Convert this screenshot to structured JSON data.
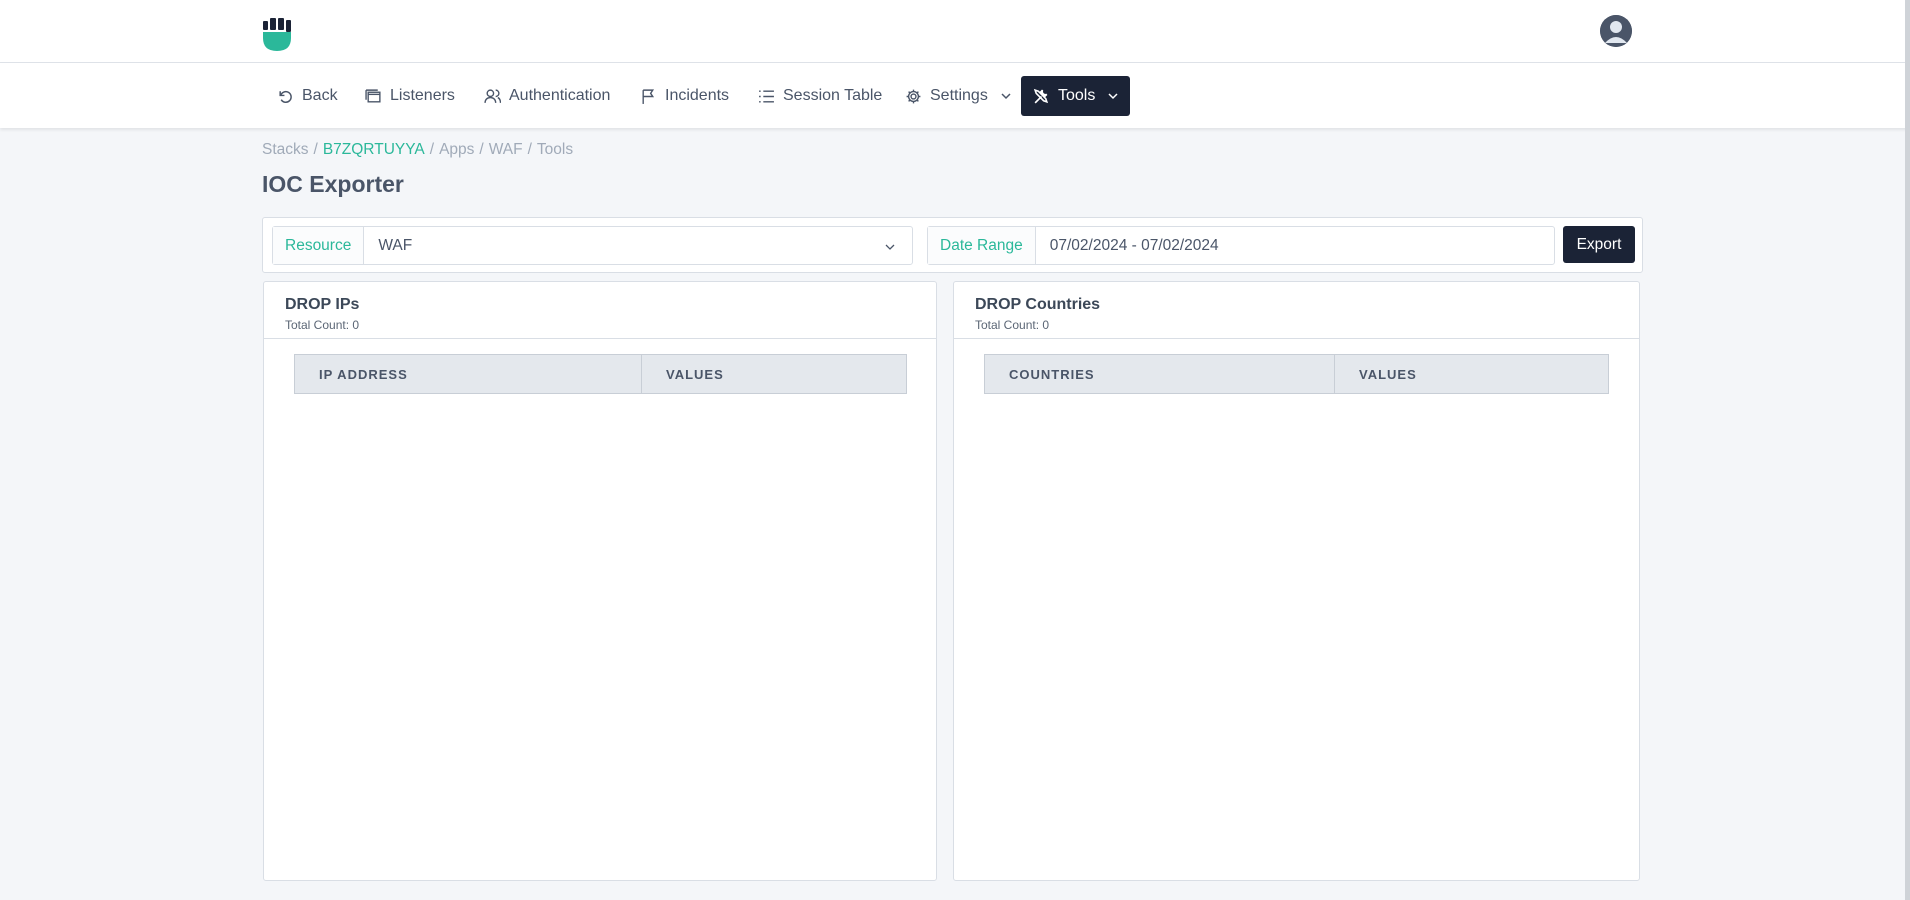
{
  "nav": {
    "back": "Back",
    "listeners": "Listeners",
    "authentication": "Authentication",
    "incidents": "Incidents",
    "session_table": "Session Table",
    "settings": "Settings",
    "tools": "Tools"
  },
  "breadcrumb": {
    "stacks": "Stacks",
    "stack_id": "B7ZQRTUYYA",
    "apps": "Apps",
    "waf": "WAF",
    "tools": "Tools",
    "separator": "/"
  },
  "page": {
    "title": "IOC Exporter"
  },
  "filters": {
    "resource_label": "Resource",
    "resource_value": "WAF",
    "date_label": "Date Range",
    "date_value": "07/02/2024 - 07/02/2024",
    "export_label": "Export"
  },
  "drop_ips": {
    "title": "DROP IPs",
    "total": "Total Count: 0",
    "columns": [
      "IP ADDRESS",
      "VALUES"
    ]
  },
  "drop_countries": {
    "title": "DROP Countries",
    "total": "Total Count: 0",
    "columns": [
      "COUNTRIES",
      "VALUES"
    ]
  },
  "colors": {
    "accent": "#2bb89a",
    "dark": "#1b2336",
    "background": "#f4f6f9"
  }
}
